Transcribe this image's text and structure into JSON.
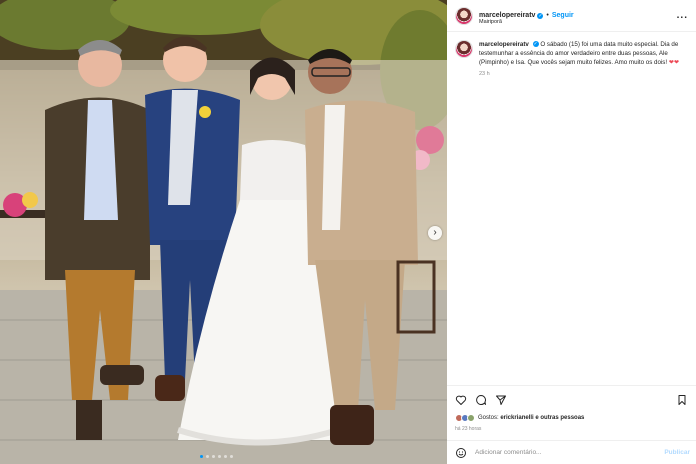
{
  "post": {
    "username": "marcelopereiratv",
    "verified_icon": "verified-badge-icon",
    "separator": "•",
    "follow_label": "Seguir",
    "location": "Mairiporã",
    "more_label": "...",
    "caption_username": "marcelopereiratv",
    "caption_text": "O sábado (15) foi uma data muito especial. Dia de testemunhar a essência do amor verdadeiro entre duas pessoas, Ale (Pimpinho) e Isa. Que vocês sejam muito felizes. Amo muito os dois!",
    "caption_hearts": "❤❤",
    "caption_time": "23 h"
  },
  "actions": {
    "icons": [
      "heart-icon",
      "comment-icon",
      "share-icon",
      "bookmark-icon"
    ],
    "likes_prefix": "Gostos: ",
    "likes_user": "erickrianelli",
    "likes_suffix": " e outras pessoas",
    "time_ago": "há 23 horas",
    "comment_placeholder": "Adicionar comentário...",
    "publish_label": "Publicar"
  },
  "carousel": {
    "next_label": "›",
    "total_slides": 6,
    "active_slide": 1
  },
  "colors": {
    "accent": "#0095f6",
    "like": "#ed4956"
  }
}
